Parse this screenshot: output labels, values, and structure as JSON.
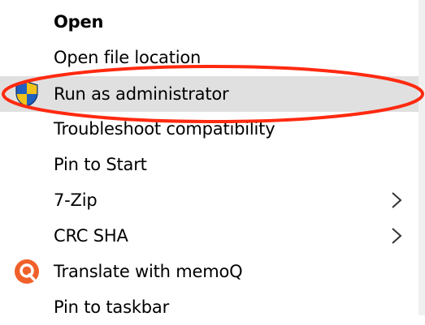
{
  "menu": {
    "items": [
      {
        "label": "Open",
        "bold": true
      },
      {
        "label": "Open file location"
      },
      {
        "label": "Run as administrator",
        "icon": "uac-shield-icon",
        "highlighted": true
      },
      {
        "label": "Troubleshoot compatibility"
      },
      {
        "label": "Pin to Start"
      },
      {
        "label": "7-Zip",
        "submenu": true
      },
      {
        "label": "CRC SHA",
        "submenu": true
      },
      {
        "label": "Translate with memoQ",
        "icon": "memoq-icon"
      },
      {
        "label": "Pin to taskbar"
      }
    ]
  },
  "colors": {
    "hover": "#e0e0e0",
    "annotation": "#ff2a10",
    "shield_blue": "#1f5fbf",
    "shield_yellow": "#f2c21a",
    "memoq_orange": "#f0602a"
  }
}
